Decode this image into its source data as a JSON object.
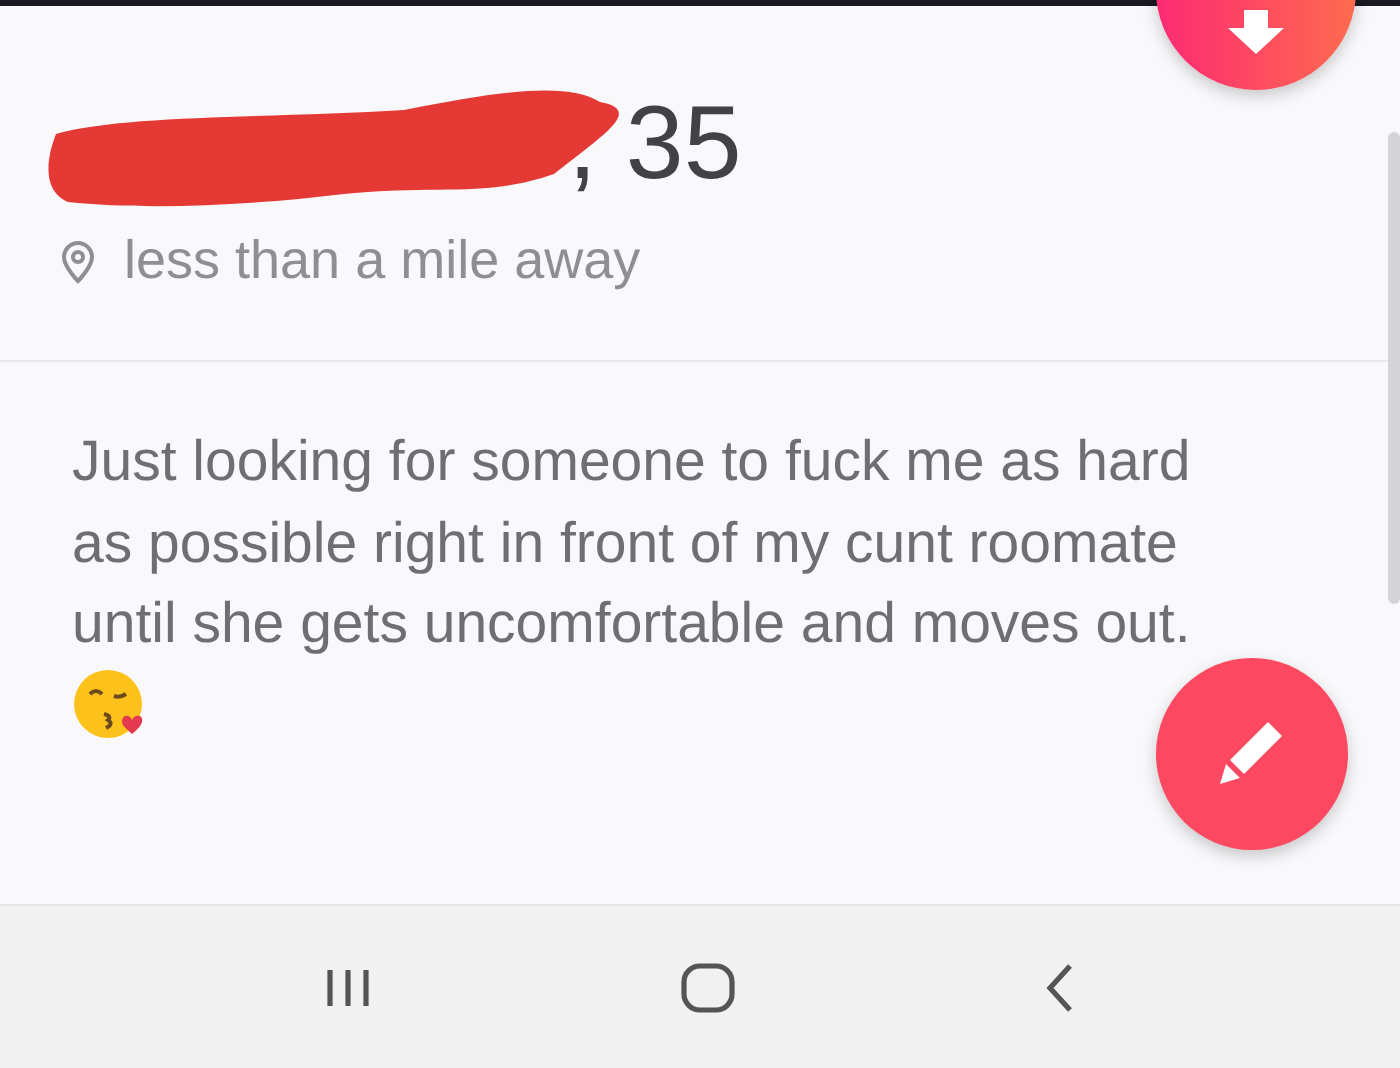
{
  "profile": {
    "name_tail": ", 35",
    "location": "less than a mile away"
  },
  "bio": {
    "text": "Just looking for someone to fuck me as hard as possible right in front of my cunt roomate until she gets uncomfortable and moves out."
  },
  "nav_bar": {
    "buttons": [
      {
        "kind": "recents"
      },
      {
        "kind": "home"
      },
      {
        "kind": "back"
      }
    ]
  }
}
